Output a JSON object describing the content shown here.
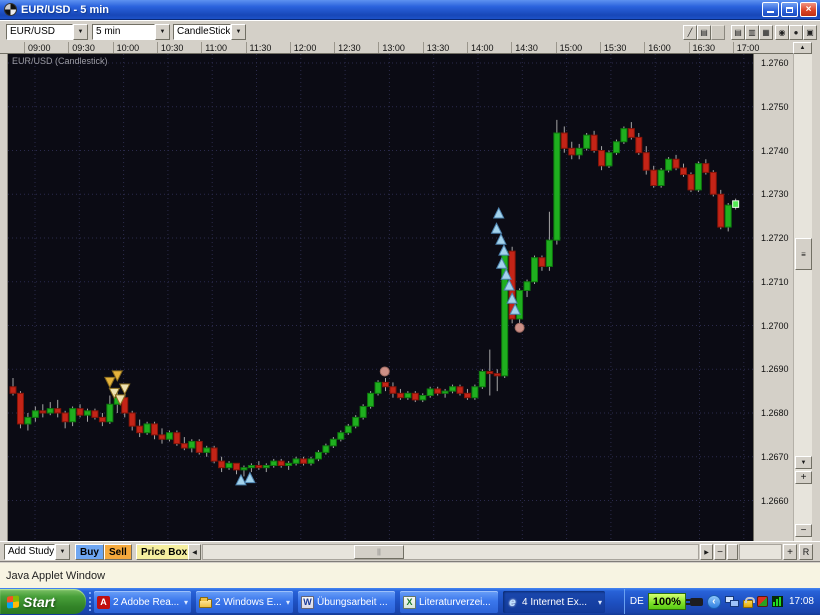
{
  "window": {
    "title": "EUR/USD - 5 min",
    "status_bar": "Java Applet Window",
    "controls": {
      "close": "×"
    }
  },
  "toolbar": {
    "symbol": "EUR/USD",
    "interval": "5 min",
    "chart_type": "CandleStick",
    "tools": [
      {
        "name": "trendline-tool",
        "glyph": "╱",
        "disabled": false
      },
      {
        "name": "study-lines-tool",
        "glyph": "▤",
        "disabled": false
      },
      {
        "name": "blank-tool",
        "glyph": "",
        "disabled": true
      },
      {
        "name": "grid-style-tool-1",
        "glyph": "▤",
        "disabled": false
      },
      {
        "name": "grid-style-tool-2",
        "glyph": "▥",
        "disabled": false
      },
      {
        "name": "grid-style-tool-3",
        "glyph": "▦",
        "disabled": false
      },
      {
        "name": "marker-style-tool-light",
        "glyph": "◉",
        "disabled": false
      },
      {
        "name": "marker-style-tool-dark",
        "glyph": "●",
        "disabled": false
      },
      {
        "name": "windows-tool",
        "glyph": "▣",
        "disabled": false
      }
    ]
  },
  "ui": {
    "dropdown_arrow": "▼",
    "task_arrow": "▾",
    "collapse_arrow": "‹"
  },
  "scroll": {
    "up": "▲",
    "down": "▼",
    "left": "◀",
    "right": "▶",
    "plus": "+",
    "minus": "−",
    "reset": "R",
    "grip": "≡",
    "hgrip": "||"
  },
  "bottom_toolbar": {
    "add_study": "Add Study",
    "buy": "Buy",
    "sell": "Sell",
    "price_box": "Price Box"
  },
  "taskbar": {
    "start": "Start",
    "tasks": [
      {
        "label": "2 Adobe Rea...",
        "icon": "adobe-reader-icon",
        "icon_glyph": "A",
        "dropdown": true,
        "active": false
      },
      {
        "label": "2 Windows E...",
        "icon": "folder-icon",
        "icon_glyph": "",
        "dropdown": true,
        "active": false
      },
      {
        "label": "Übungsarbeit ...",
        "icon": "word-icon",
        "icon_glyph": "W",
        "dropdown": false,
        "active": false
      },
      {
        "label": "Literaturverzei...",
        "icon": "excel-icon",
        "icon_glyph": "X",
        "dropdown": false,
        "active": false
      },
      {
        "label": "4 Internet Ex...",
        "icon": "ie-icon",
        "icon_glyph": "e",
        "dropdown": true,
        "active": true
      }
    ],
    "tray": {
      "language": "DE",
      "volume": "100%",
      "clock": "17:08"
    }
  },
  "chart_data": {
    "type": "candlestick",
    "symbol": "EUR/USD",
    "interval": "5 min",
    "label": "EUR/USD (Candlestick)",
    "start_time": "09:00",
    "minutes_per_candle": 5,
    "x_labels": [
      "09:00",
      "09:30",
      "10:00",
      "10:30",
      "11:00",
      "11:30",
      "12:00",
      "12:30",
      "13:00",
      "13:30",
      "14:00",
      "14:30",
      "15:00",
      "15:30",
      "16:00",
      "16:30",
      "17:00"
    ],
    "y_labels": [
      "1.2760",
      "1.2750",
      "1.2740",
      "1.2730",
      "1.2720",
      "1.2710",
      "1.2700",
      "1.2690",
      "1.2680",
      "1.2670",
      "1.2660"
    ],
    "y_axis": {
      "max": 1.276,
      "min": 1.266
    },
    "grid": true,
    "colors": {
      "bg": "#0b0b14",
      "grid": "#2b2b4c",
      "wick": "#a6a6a6",
      "up": "#1faf1f",
      "up_border": "#0e7a0e",
      "down": "#c42417",
      "down_border": "#871508",
      "last": "#55e855",
      "last_border": "#e6ffe6",
      "buy_marker": "#a3d3ec",
      "buy_marker_border": "#4e84b0",
      "sell_marker_gold": "#e6b33c",
      "sell_marker_pale": "#efe2b0",
      "sell_marker_border": "#8a6d1f",
      "dot": "#cd9087",
      "dot_border": "#9f6b62"
    },
    "ohlc": [
      [
        1.2686,
        1.2688,
        1.2684,
        1.26845
      ],
      [
        1.26845,
        1.2685,
        1.26765,
        1.26775
      ],
      [
        1.26775,
        1.268,
        1.2676,
        1.2679
      ],
      [
        1.2679,
        1.26815,
        1.2678,
        1.26805
      ],
      [
        1.26805,
        1.2682,
        1.2679,
        1.268
      ],
      [
        1.268,
        1.26825,
        1.26795,
        1.2681
      ],
      [
        1.2681,
        1.2683,
        1.2679,
        1.268
      ],
      [
        1.268,
        1.26805,
        1.26765,
        1.2678
      ],
      [
        1.2678,
        1.26815,
        1.2677,
        1.2681
      ],
      [
        1.2681,
        1.2682,
        1.2679,
        1.26795
      ],
      [
        1.26795,
        1.2681,
        1.2678,
        1.26805
      ],
      [
        1.26805,
        1.2681,
        1.26785,
        1.2679
      ],
      [
        1.2679,
        1.268,
        1.2677,
        1.2678
      ],
      [
        1.2678,
        1.2684,
        1.26775,
        1.2682
      ],
      [
        1.2682,
        1.2685,
        1.268,
        1.26835
      ],
      [
        1.26835,
        1.26845,
        1.2679,
        1.268
      ],
      [
        1.268,
        1.26805,
        1.2676,
        1.2677
      ],
      [
        1.2677,
        1.26785,
        1.26745,
        1.26755
      ],
      [
        1.26755,
        1.2678,
        1.2675,
        1.26775
      ],
      [
        1.26775,
        1.2678,
        1.2674,
        1.2675
      ],
      [
        1.2675,
        1.26765,
        1.2673,
        1.2674
      ],
      [
        1.2674,
        1.2676,
        1.26735,
        1.26755
      ],
      [
        1.26755,
        1.2676,
        1.26725,
        1.2673
      ],
      [
        1.2673,
        1.26745,
        1.26715,
        1.2672
      ],
      [
        1.2672,
        1.2674,
        1.2671,
        1.26735
      ],
      [
        1.26735,
        1.2674,
        1.26705,
        1.2671
      ],
      [
        1.2671,
        1.26725,
        1.267,
        1.2672
      ],
      [
        1.2672,
        1.26725,
        1.26685,
        1.2669
      ],
      [
        1.2669,
        1.267,
        1.26665,
        1.26675
      ],
      [
        1.26675,
        1.2669,
        1.2667,
        1.26685
      ],
      [
        1.26685,
        1.26685,
        1.2666,
        1.2667
      ],
      [
        1.2667,
        1.2668,
        1.26655,
        1.26675
      ],
      [
        1.26675,
        1.26685,
        1.26665,
        1.2668
      ],
      [
        1.2668,
        1.2669,
        1.2667,
        1.26675
      ],
      [
        1.26675,
        1.26685,
        1.26665,
        1.2668
      ],
      [
        1.2668,
        1.26695,
        1.26675,
        1.2669
      ],
      [
        1.2669,
        1.26695,
        1.26675,
        1.2668
      ],
      [
        1.2668,
        1.2669,
        1.2667,
        1.26685
      ],
      [
        1.26685,
        1.267,
        1.2668,
        1.26695
      ],
      [
        1.26695,
        1.267,
        1.2668,
        1.26685
      ],
      [
        1.26685,
        1.267,
        1.2668,
        1.26695
      ],
      [
        1.26695,
        1.26715,
        1.2669,
        1.2671
      ],
      [
        1.2671,
        1.2673,
        1.26705,
        1.26725
      ],
      [
        1.26725,
        1.26745,
        1.2672,
        1.2674
      ],
      [
        1.2674,
        1.2676,
        1.26735,
        1.26755
      ],
      [
        1.26755,
        1.26775,
        1.2675,
        1.2677
      ],
      [
        1.2677,
        1.26795,
        1.26765,
        1.2679
      ],
      [
        1.2679,
        1.2682,
        1.26785,
        1.26815
      ],
      [
        1.26815,
        1.2685,
        1.2681,
        1.26845
      ],
      [
        1.26845,
        1.26875,
        1.2684,
        1.2687
      ],
      [
        1.2687,
        1.2688,
        1.2685,
        1.2686
      ],
      [
        1.2686,
        1.2687,
        1.26835,
        1.26845
      ],
      [
        1.26845,
        1.26855,
        1.2683,
        1.26835
      ],
      [
        1.26835,
        1.2685,
        1.2683,
        1.26845
      ],
      [
        1.26845,
        1.2685,
        1.26825,
        1.2683
      ],
      [
        1.2683,
        1.26845,
        1.26825,
        1.2684
      ],
      [
        1.2684,
        1.2686,
        1.26835,
        1.26855
      ],
      [
        1.26855,
        1.2686,
        1.2684,
        1.26845
      ],
      [
        1.26845,
        1.26855,
        1.26835,
        1.2685
      ],
      [
        1.2685,
        1.26865,
        1.26845,
        1.2686
      ],
      [
        1.2686,
        1.26865,
        1.2684,
        1.26845
      ],
      [
        1.26845,
        1.26855,
        1.2683,
        1.26835
      ],
      [
        1.26835,
        1.26865,
        1.2683,
        1.2686
      ],
      [
        1.2686,
        1.269,
        1.26855,
        1.26895
      ],
      [
        1.26895,
        1.26945,
        1.2684,
        1.2689
      ],
      [
        1.2689,
        1.269,
        1.2685,
        1.26885
      ],
      [
        1.26885,
        1.2718,
        1.2688,
        1.2717
      ],
      [
        1.2717,
        1.2718,
        1.27005,
        1.27015
      ],
      [
        1.27015,
        1.27085,
        1.27,
        1.2708
      ],
      [
        1.2708,
        1.27105,
        1.27065,
        1.271
      ],
      [
        1.271,
        1.2716,
        1.27095,
        1.27155
      ],
      [
        1.27155,
        1.2716,
        1.27125,
        1.27135
      ],
      [
        1.27135,
        1.2726,
        1.27125,
        1.27195
      ],
      [
        1.27195,
        1.2747,
        1.27185,
        1.2744
      ],
      [
        1.2744,
        1.27455,
        1.27395,
        1.27405
      ],
      [
        1.27405,
        1.2742,
        1.2738,
        1.2739
      ],
      [
        1.2739,
        1.27415,
        1.2738,
        1.27405
      ],
      [
        1.27405,
        1.2744,
        1.274,
        1.27435
      ],
      [
        1.27435,
        1.27445,
        1.27395,
        1.274
      ],
      [
        1.274,
        1.2741,
        1.27355,
        1.27365
      ],
      [
        1.27365,
        1.274,
        1.2736,
        1.27395
      ],
      [
        1.27395,
        1.27425,
        1.2739,
        1.2742
      ],
      [
        1.2742,
        1.27455,
        1.27415,
        1.2745
      ],
      [
        1.2745,
        1.27465,
        1.27425,
        1.2743
      ],
      [
        1.2743,
        1.2744,
        1.2739,
        1.27395
      ],
      [
        1.27395,
        1.2741,
        1.27345,
        1.27355
      ],
      [
        1.27355,
        1.27365,
        1.27315,
        1.2732
      ],
      [
        1.2732,
        1.2736,
        1.27315,
        1.27355
      ],
      [
        1.27355,
        1.27385,
        1.2735,
        1.2738
      ],
      [
        1.2738,
        1.2739,
        1.27355,
        1.2736
      ],
      [
        1.2736,
        1.2737,
        1.2734,
        1.27345
      ],
      [
        1.27345,
        1.2735,
        1.27305,
        1.2731
      ],
      [
        1.2731,
        1.27375,
        1.27305,
        1.2737
      ],
      [
        1.2737,
        1.2738,
        1.27345,
        1.2735
      ],
      [
        1.2735,
        1.27355,
        1.27295,
        1.273
      ],
      [
        1.273,
        1.2731,
        1.2722,
        1.27225
      ],
      [
        1.27225,
        1.2728,
        1.27215,
        1.27275
      ],
      [
        1.2727,
        1.2729,
        1.27265,
        1.27285
      ]
    ],
    "markers": [
      {
        "type": "sell",
        "i": 13,
        "price": 1.2687,
        "variant": "gold"
      },
      {
        "type": "sell",
        "i": 14,
        "price": 1.26885,
        "variant": "gold"
      },
      {
        "type": "sell",
        "i": 13.6,
        "price": 1.26845,
        "variant": "pale"
      },
      {
        "type": "sell",
        "i": 14.4,
        "price": 1.2683,
        "variant": "pale"
      },
      {
        "type": "sell",
        "i": 15,
        "price": 1.26855,
        "variant": "pale"
      },
      {
        "type": "buy",
        "i": 30.6,
        "price": 1.26645
      },
      {
        "type": "buy",
        "i": 31.8,
        "price": 1.2665
      },
      {
        "type": "buy",
        "i": 64.9,
        "price": 1.2722
      },
      {
        "type": "buy",
        "i": 65.2,
        "price": 1.27255
      },
      {
        "type": "buy",
        "i": 65.5,
        "price": 1.27195
      },
      {
        "type": "buy",
        "i": 65.9,
        "price": 1.2717
      },
      {
        "type": "buy",
        "i": 65.6,
        "price": 1.2714
      },
      {
        "type": "buy",
        "i": 66.2,
        "price": 1.27115
      },
      {
        "type": "buy",
        "i": 66.6,
        "price": 1.2709
      },
      {
        "type": "buy",
        "i": 67,
        "price": 1.2706
      },
      {
        "type": "buy",
        "i": 67.4,
        "price": 1.27035
      },
      {
        "type": "dot",
        "i": 49.9,
        "price": 1.26895
      },
      {
        "type": "dot",
        "i": 68,
        "price": 1.26995
      }
    ]
  }
}
